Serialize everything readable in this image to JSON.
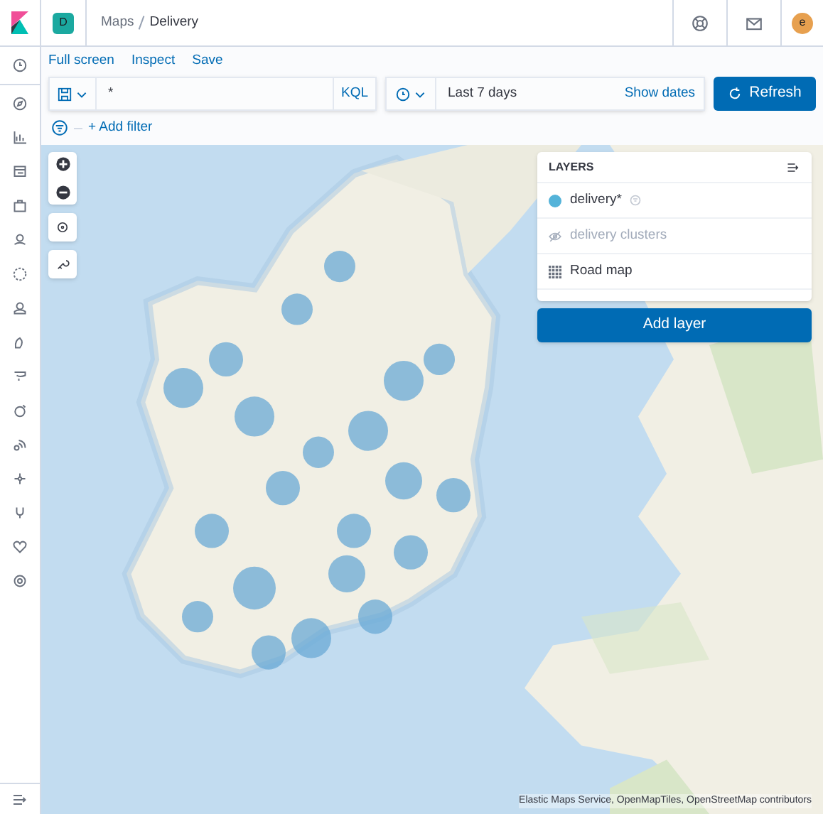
{
  "header": {
    "space_initial": "D",
    "breadcrumbs": [
      "Maps",
      "Delivery"
    ],
    "avatar_initial": "e"
  },
  "top_links": [
    "Full screen",
    "Inspect",
    "Save"
  ],
  "query": {
    "value": "*",
    "language": "KQL"
  },
  "time": {
    "range": "Last 7 days",
    "show_dates": "Show dates"
  },
  "refresh_button": "Refresh",
  "add_filter": "+ Add filter",
  "layers_panel": {
    "title": "LAYERS",
    "items": [
      {
        "label": "delivery*",
        "kind": "points",
        "color": "#54b3d9",
        "visible": true
      },
      {
        "label": "delivery clusters",
        "kind": "clusters",
        "visible": false
      },
      {
        "label": "Road map",
        "kind": "tiles",
        "visible": true
      }
    ],
    "add_layer": "Add layer"
  },
  "attribution": "Elastic Maps Service, OpenMapTiles, OpenStreetMap contributors"
}
